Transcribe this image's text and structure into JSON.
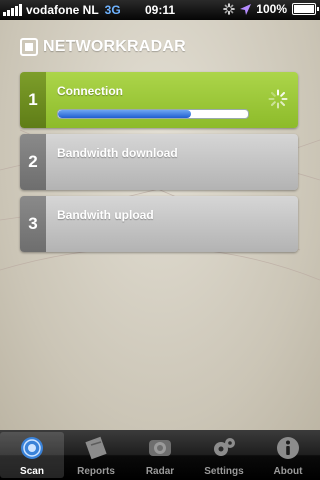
{
  "status_bar": {
    "carrier": "vodafone NL",
    "network": "3G",
    "time": "09:11",
    "battery": "100%"
  },
  "header": {
    "title": "NETWORKRADAR"
  },
  "steps": [
    {
      "number": "1",
      "label": "Connection",
      "state": "active",
      "progress": 0.7
    },
    {
      "number": "2",
      "label": "Bandwidth download",
      "state": "idle"
    },
    {
      "number": "3",
      "label": "Bandwith upload",
      "state": "idle"
    }
  ],
  "tabs": [
    {
      "label": "Scan",
      "icon": "scan-icon",
      "active": true
    },
    {
      "label": "Reports",
      "icon": "reports-icon",
      "active": false
    },
    {
      "label": "Radar",
      "icon": "radar-icon",
      "active": false
    },
    {
      "label": "Settings",
      "icon": "gears-icon",
      "active": false
    },
    {
      "label": "About",
      "icon": "info-icon",
      "active": false
    }
  ],
  "colors": {
    "active_green": "#9ccb3a",
    "progress_blue": "#2f6fdc",
    "idle_gray": "#c4c4c4"
  }
}
